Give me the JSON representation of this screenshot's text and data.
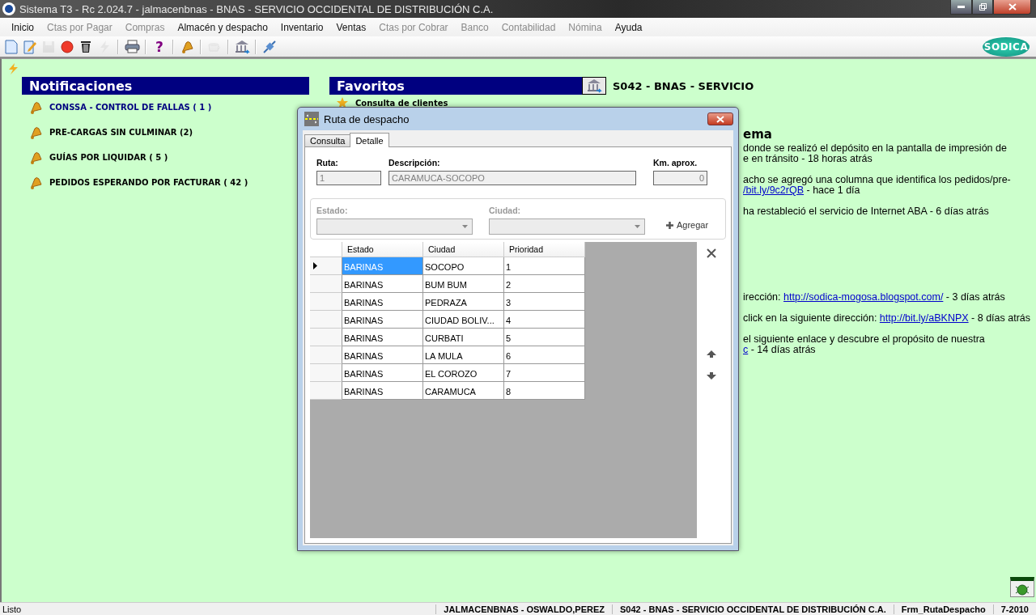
{
  "window": {
    "title": "Sistema T3 - Rc 2.024.7 - jalmacenbnas - BNAS - SERVICIO OCCIDENTAL DE DISTRIBUCIÓN C.A."
  },
  "menu": [
    {
      "label": "Inicio",
      "disabled": false
    },
    {
      "label": "Ctas por Pagar",
      "disabled": true
    },
    {
      "label": "Compras",
      "disabled": true
    },
    {
      "label": "Almacén y despacho",
      "disabled": false
    },
    {
      "label": "Inventario",
      "disabled": false
    },
    {
      "label": "Ventas",
      "disabled": false
    },
    {
      "label": "Ctas por Cobrar",
      "disabled": true
    },
    {
      "label": "Banco",
      "disabled": true
    },
    {
      "label": "Contabilidad",
      "disabled": true
    },
    {
      "label": "Nómina",
      "disabled": true
    },
    {
      "label": "Ayuda",
      "disabled": false
    }
  ],
  "toolbar": [
    {
      "kind": "new",
      "disabled": false
    },
    {
      "kind": "edit",
      "disabled": false
    },
    {
      "kind": "save",
      "disabled": true
    },
    {
      "kind": "record",
      "disabled": false
    },
    {
      "kind": "delete",
      "disabled": false
    },
    {
      "kind": "flash",
      "disabled": true
    },
    {
      "kind": "separator"
    },
    {
      "kind": "print",
      "disabled": false
    },
    {
      "kind": "separator"
    },
    {
      "kind": "help",
      "label": "?",
      "disabled": false
    },
    {
      "kind": "separator"
    },
    {
      "kind": "bell",
      "disabled": false
    },
    {
      "kind": "separator"
    },
    {
      "kind": "cup",
      "disabled": true
    },
    {
      "kind": "separator"
    },
    {
      "kind": "bank",
      "disabled": false
    },
    {
      "kind": "separator"
    },
    {
      "kind": "plug",
      "disabled": false
    }
  ],
  "logo": {
    "text": "SODICA"
  },
  "notifications": {
    "title": "Notificaciones",
    "items": [
      {
        "label": "CONSSA - CONTROL DE FALLAS ( 1 )",
        "highlighted": true
      },
      {
        "label": "PRE-CARGAS SIN CULMINAR  (2)",
        "highlighted": false
      },
      {
        "label": "GUÍAS POR LIQUIDAR  ( 5 )",
        "highlighted": false
      },
      {
        "label": "PEDIDOS ESPERANDO POR FACTURAR  ( 42 )",
        "highlighted": false
      }
    ]
  },
  "favorites": {
    "title": "Favoritos",
    "items": [
      {
        "label": "Consulta de clientes"
      }
    ]
  },
  "company": {
    "title": "S042 - BNAS - SERVICIO"
  },
  "news": {
    "title": "ema",
    "groups": [
      {
        "items": [
          {
            "lines": [
              {
                "text": "donde se realizó el depósito en la pantalla de impresión de"
              },
              {
                "text": "e en tránsito - 18 horas atrás"
              }
            ]
          },
          {
            "lines": [
              {
                "text": "acho se agregó una columna que identifica los pedidos/pre-"
              },
              {
                "link": "/bit.ly/9c2rQB",
                "after": " - hace 1 día"
              }
            ]
          },
          {
            "lines": [
              {
                "text": "ha restableció el servicio de Internet ABA - 6 días atrás"
              }
            ]
          }
        ]
      },
      {
        "items": [
          {
            "lines": [
              {
                "text": "irección: ",
                "link": "http://sodica-mogosa.blogspot.com/",
                "after": " - 3 días atrás"
              }
            ]
          },
          {
            "lines": [
              {
                "text": "click en la siguiente dirección: ",
                "link": "http://bit.ly/aBKNPX",
                "after": " - 8 días atrás"
              }
            ]
          },
          {
            "lines": [
              {
                "text": "el siguiente enlace y descubre el propósito de nuestra"
              },
              {
                "link": "c",
                "after": " - 14 días atrás"
              }
            ]
          }
        ]
      }
    ]
  },
  "dialog": {
    "title": "Ruta de despacho",
    "tabs": [
      {
        "label": "Consulta",
        "selected": false
      },
      {
        "label": "Detalle",
        "selected": true
      }
    ],
    "fields": [
      {
        "label": "Ruta:",
        "value": "1",
        "disabled": true
      },
      {
        "label": "Descripción:",
        "value": "CARAMUCA-SOCOPO",
        "disabled": true
      },
      {
        "label": "Km. aprox.",
        "value": "0",
        "disabled": true
      }
    ],
    "filters": [
      {
        "label": "Estado:",
        "disabled": true
      },
      {
        "label": "Ciudad:",
        "disabled": true
      }
    ],
    "add_button": "Agregar",
    "grid": {
      "columns": [
        "Estado",
        "Ciudad",
        "Prioridad"
      ],
      "rows": [
        {
          "cells": [
            "BARINAS",
            "SOCOPO",
            "1"
          ],
          "selected": true
        },
        {
          "cells": [
            "BARINAS",
            "BUM BUM",
            "2"
          ],
          "selected": false
        },
        {
          "cells": [
            "BARINAS",
            "PEDRAZA",
            "3"
          ],
          "selected": false
        },
        {
          "cells": [
            "BARINAS",
            "CIUDAD BOLIV...",
            "4"
          ],
          "selected": false
        },
        {
          "cells": [
            "BARINAS",
            "CURBATI",
            "5"
          ],
          "selected": false
        },
        {
          "cells": [
            "BARINAS",
            "LA MULA",
            "6"
          ],
          "selected": false
        },
        {
          "cells": [
            "BARINAS",
            "EL COROZO",
            "7"
          ],
          "selected": false
        },
        {
          "cells": [
            "BARINAS",
            "CARAMUCA",
            "8"
          ],
          "selected": false
        }
      ]
    }
  },
  "status_bar": [
    "Listo",
    "JALMACENBNAS - OSWALDO,PEREZ",
    "S042 - BNAS - SERVICIO OCCIDENTAL DE DISTRIBUCIÓN C.A.",
    "Frm_RutaDespacho",
    "7-2010"
  ]
}
